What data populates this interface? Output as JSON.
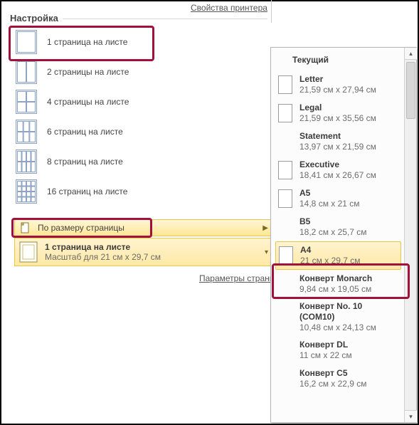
{
  "top_link": "Свойства принтера",
  "section_title": "Настройка",
  "pages_per_sheet": [
    {
      "label": "1 страница на листе",
      "cols": 1,
      "rows": 1,
      "highlight": true
    },
    {
      "label": "2 страницы на листе",
      "cols": 2,
      "rows": 1
    },
    {
      "label": "4 страницы на листе",
      "cols": 2,
      "rows": 2
    },
    {
      "label": "6 страниц на листе",
      "cols": 3,
      "rows": 2
    },
    {
      "label": "8 страниц на листе",
      "cols": 4,
      "rows": 2
    },
    {
      "label": "16 страниц на листе",
      "cols": 4,
      "rows": 4
    }
  ],
  "submenu_label": "По размеру страницы",
  "selected": {
    "title": "1 страница на листе",
    "subtitle": "Масштаб для 21 см x 29,7 см"
  },
  "page_params_link": "Параметры страницы",
  "flyout": {
    "heading": "Текущий",
    "items": [
      {
        "name": "Letter",
        "dims": "21,59 см x 27,94 см",
        "icon": true
      },
      {
        "name": "Legal",
        "dims": "21,59 см x 35,56 см",
        "icon": true
      },
      {
        "name": "Statement",
        "dims": "13,97 см x 21,59 см",
        "icon": false
      },
      {
        "name": "Executive",
        "dims": "18,41 см x 26,67 см",
        "icon": true
      },
      {
        "name": "A5",
        "dims": "14,8 см x 21 см",
        "icon": true
      },
      {
        "name": "B5",
        "dims": "18,2 см x 25,7 см",
        "icon": false
      },
      {
        "name": "A4",
        "dims": "21 см x 29,7 см",
        "icon": true,
        "selected": true
      },
      {
        "name": "Конверт Monarch",
        "dims": "9,84 см x 19,05 см",
        "icon": false
      },
      {
        "name": "Конверт No. 10 (COM10)",
        "dims": "10,48 см x 24,13 см",
        "icon": false
      },
      {
        "name": "Конверт DL",
        "dims": "11 см x 22 см",
        "icon": false
      },
      {
        "name": "Конверт C5",
        "dims": "16,2 см x 22,9 см",
        "icon": false
      }
    ]
  }
}
